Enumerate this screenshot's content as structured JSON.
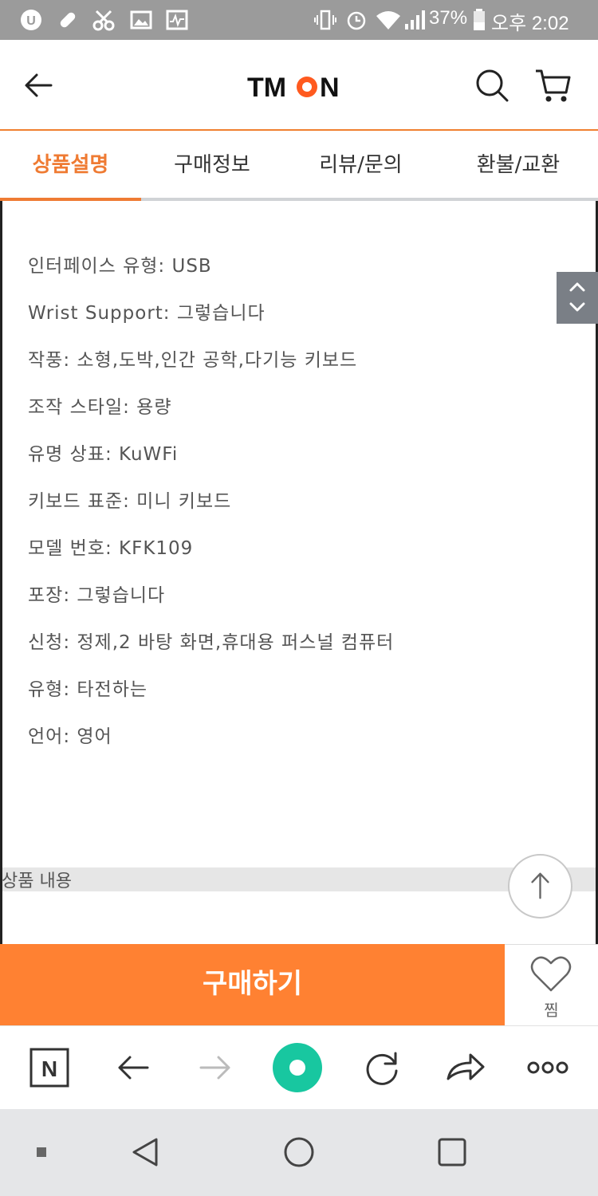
{
  "status_bar": {
    "battery_percent": "37%",
    "time": "오후 2:02"
  },
  "header": {
    "brand": "TMON",
    "icons": {
      "back": "arrow-left-icon",
      "search": "search-icon",
      "cart": "cart-icon"
    }
  },
  "tabs": [
    {
      "label": "상품설명",
      "active": true
    },
    {
      "label": "구매정보",
      "active": false
    },
    {
      "label": "리뷰/문의",
      "active": false
    },
    {
      "label": "환불/교환",
      "active": false
    }
  ],
  "specs": [
    "인터페이스 유형: USB",
    "Wrist Support: 그렇습니다",
    "작풍: 소형,도박,인간 공학,다기능 키보드",
    "조작 스타일: 용량",
    "유명 상표: KuWFi",
    "키보드 표준: 미니 키보드",
    "모델 번호: KFK109",
    "포장: 그렇습니다",
    "신청: 정제,2 바탕 화면,휴대용 퍼스널 컴퓨터",
    "유형: 타전하는",
    "언어: 영어"
  ],
  "product_content_label": "상품 내용",
  "buy_label": "구매하기",
  "wish_label": "찜",
  "colors": {
    "accent": "#ef7b33",
    "buy_button": "#ff8132",
    "status_bar": "#9b9b9b",
    "nav_bar": "#e5e6e8",
    "green_button": "#18c7a0"
  },
  "browser_toolbar_icons": [
    "naver-n-icon",
    "back-arrow-icon",
    "forward-arrow-icon",
    "green-home-icon",
    "refresh-icon",
    "share-icon",
    "more-icon"
  ],
  "android_nav_icons": [
    "square-dot-icon",
    "triangle-back-icon",
    "circle-home-icon",
    "square-recent-icon"
  ]
}
